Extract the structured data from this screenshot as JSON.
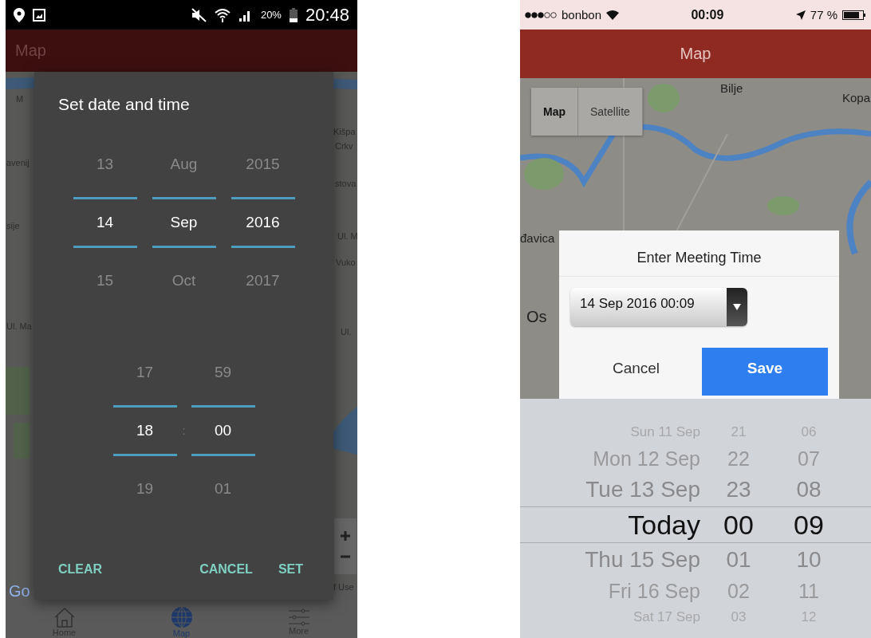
{
  "android": {
    "status_bar": {
      "battery": "20%",
      "time": "20:48"
    },
    "app_bar": {
      "title": "Map"
    },
    "map_labels": [
      "M",
      "Kišpa",
      "Crkv",
      "avenij",
      "stova",
      "sije",
      "Ul. M",
      "Vuko",
      "Ul. Ma",
      "Ul.",
      "Go",
      "f Use"
    ],
    "dialog": {
      "title": "Set date and time",
      "date_columns": [
        {
          "items": [
            {
              "text": "13",
              "selected": false
            },
            {
              "text": "14",
              "selected": true
            },
            {
              "text": "15",
              "selected": false
            }
          ]
        },
        {
          "items": [
            {
              "text": "Aug",
              "selected": false
            },
            {
              "text": "Sep",
              "selected": true
            },
            {
              "text": "Oct",
              "selected": false
            }
          ]
        },
        {
          "items": [
            {
              "text": "2015",
              "selected": false
            },
            {
              "text": "2016",
              "selected": true
            },
            {
              "text": "2017",
              "selected": false
            }
          ]
        }
      ],
      "time_columns": [
        {
          "items": [
            {
              "text": "17",
              "selected": false
            },
            {
              "text": "18",
              "selected": true
            },
            {
              "text": "19",
              "selected": false
            }
          ]
        },
        {
          "items": [
            {
              "text": "59",
              "selected": false
            },
            {
              "text": "00",
              "selected": true
            },
            {
              "text": "01",
              "selected": false
            }
          ]
        }
      ],
      "separator": ":",
      "buttons": [
        {
          "label": "CLEAR",
          "kind": "left"
        },
        {
          "label": "CANCEL",
          "kind": "right"
        },
        {
          "label": "SET",
          "kind": "right"
        }
      ]
    },
    "bottom_nav": [
      {
        "label": "Home",
        "kind": "home",
        "selected": false
      },
      {
        "label": "Map",
        "kind": "globe",
        "selected": true
      },
      {
        "label": "More",
        "kind": "sliders",
        "selected": false
      }
    ]
  },
  "ios": {
    "status_bar": {
      "carrier": "bonbon",
      "time": "00:09",
      "battery": "77 %"
    },
    "nav_bar": {
      "title": "Map"
    },
    "map_type": [
      {
        "label": "Map",
        "selected": true
      },
      {
        "label": "Satellite",
        "selected": false
      }
    ],
    "map_labels": [
      "Bilje",
      "Kopa",
      "đavica",
      "Os"
    ],
    "dialog": {
      "title": "Enter Meeting Time",
      "field": {
        "value": "14 Sep 2016 00:09"
      },
      "buttons": [
        {
          "label": "Cancel",
          "kind": "plain"
        },
        {
          "label": "Save",
          "kind": "primary"
        }
      ]
    },
    "picker": {
      "rows": [
        {
          "date": "Sun 11 Sep",
          "hour": "21",
          "minute": "06",
          "selected": false
        },
        {
          "date": "Mon 12 Sep",
          "hour": "22",
          "minute": "07",
          "selected": false
        },
        {
          "date": "Tue 13 Sep",
          "hour": "23",
          "minute": "08",
          "selected": false
        },
        {
          "date": "Today",
          "hour": "00",
          "minute": "09",
          "selected": true
        },
        {
          "date": "Thu 15 Sep",
          "hour": "01",
          "minute": "10",
          "selected": false
        },
        {
          "date": "Fri 16 Sep",
          "hour": "02",
          "minute": "11",
          "selected": false
        },
        {
          "date": "Sat 17 Sep",
          "hour": "03",
          "minute": "12",
          "selected": false
        }
      ]
    }
  }
}
